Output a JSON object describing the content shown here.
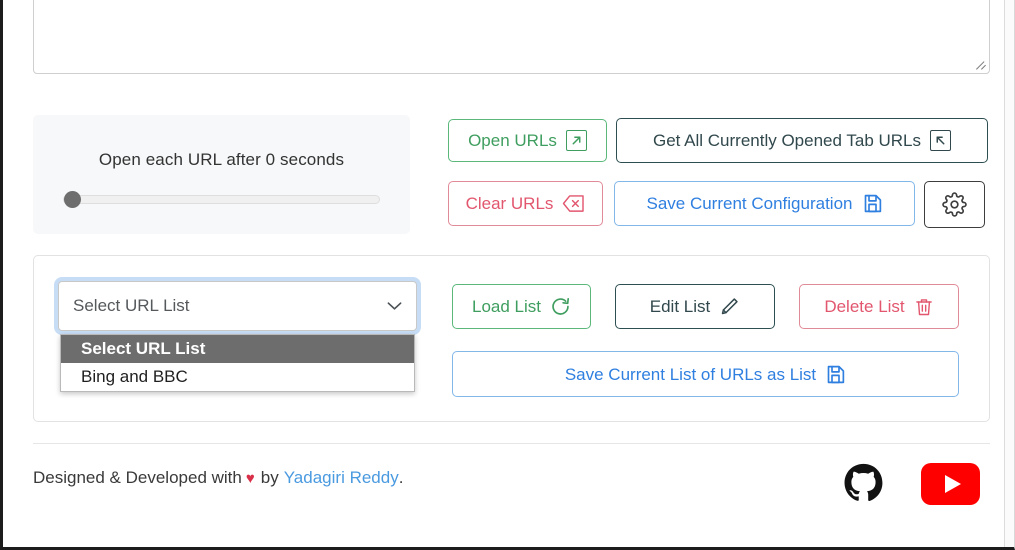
{
  "urls_textarea": {
    "value": "",
    "placeholder": ""
  },
  "delay": {
    "label": "Open each URL after 0 seconds",
    "seconds": 0,
    "slider_min": 0,
    "slider_max": 60,
    "slider_value": 0
  },
  "actions": {
    "open_urls": "Open URLs",
    "open_urls_icon": "arrow-up-right-box-icon",
    "get_all_tabs": "Get All Currently Opened Tab URLs",
    "get_all_tabs_icon": "arrow-up-left-box-icon",
    "clear_urls": "Clear URLs",
    "clear_urls_icon": "backspace-delete-icon",
    "save_configuration": "Save Current Configuration",
    "save_configuration_icon": "floppy-save-icon",
    "settings_icon": "gear-icon"
  },
  "list_section": {
    "select_value": "Select URL List",
    "select_caret_icon": "chevron-down-icon",
    "options": [
      {
        "label": "Select URL List",
        "selected": true
      },
      {
        "label": "Bing and BBC",
        "selected": false
      }
    ],
    "load_list": "Load List",
    "load_list_icon": "refresh-icon",
    "edit_list": "Edit List",
    "edit_list_icon": "pencil-icon",
    "delete_list": "Delete List",
    "delete_list_icon": "trash-icon",
    "save_current_list": "Save Current List of URLs as List",
    "save_current_list_icon": "floppy-save-icon"
  },
  "footer": {
    "credit_prefix": "Designed & Developed with",
    "heart": "♥",
    "credit_by": "by",
    "author": "Yadagiri Reddy",
    "credit_suffix": ".",
    "github_icon": "github-icon",
    "youtube_icon": "youtube-icon"
  },
  "colors": {
    "green": "#3f9e5f",
    "red": "#e2566e",
    "blue": "#2f7fe0",
    "dark": "#31484d",
    "highlight": "#6d6d6d",
    "link": "#4a9ae0",
    "youtube_red": "#ff0000"
  }
}
